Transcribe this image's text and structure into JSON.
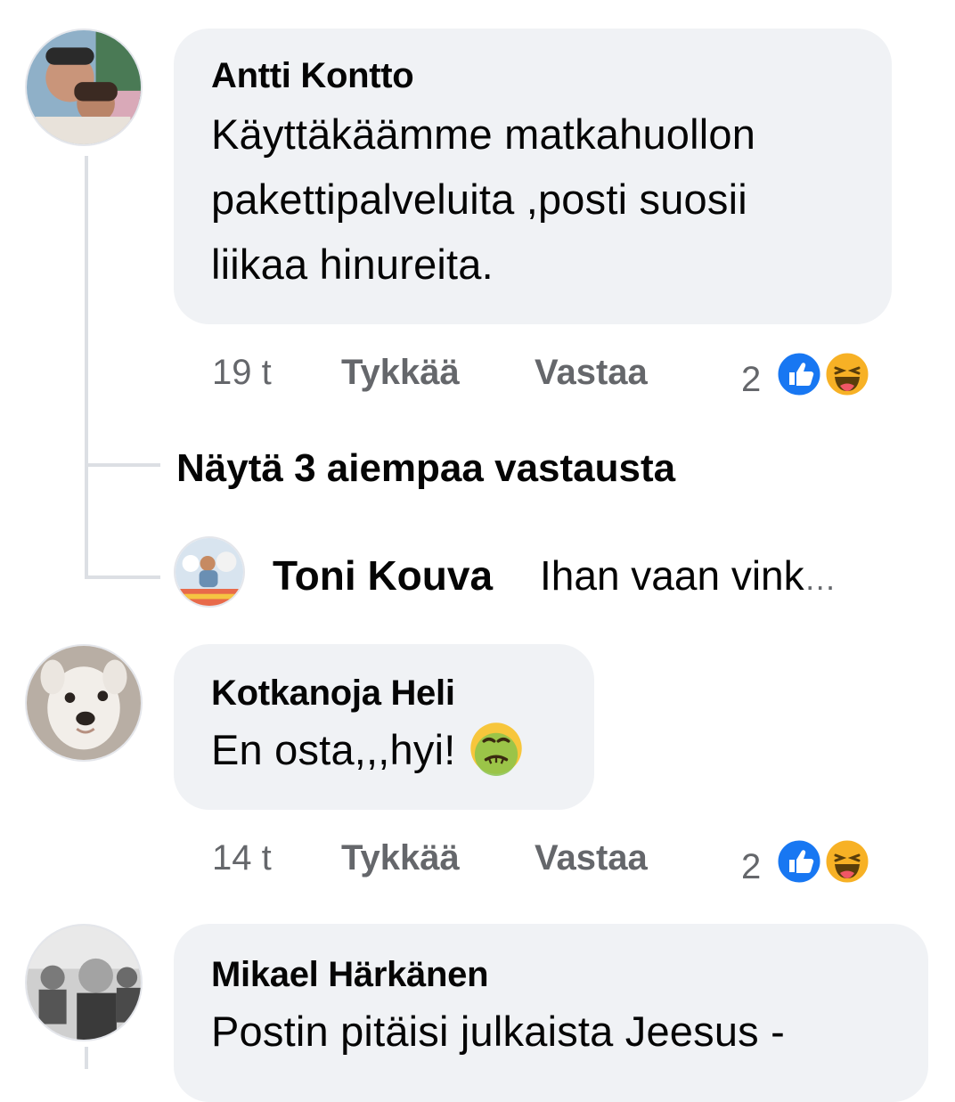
{
  "comments": [
    {
      "author": "Antti Kontto",
      "lines": [
        "Käyttäkäämme matkahuollon",
        "pakettipalveluita ,posti suosii",
        "liikaa hinureita."
      ],
      "time": "19 t",
      "like_label": "Tykkää",
      "reply_label": "Vastaa",
      "reaction_count": "2",
      "reactions": [
        "like-icon",
        "haha-icon"
      ]
    },
    {
      "author": "Kotkanoja Heli",
      "text": "En osta,,,hyi!",
      "emoji": "nauseated-face-icon",
      "time": "14 t",
      "like_label": "Tykkää",
      "reply_label": "Vastaa",
      "reaction_count": "2",
      "reactions": [
        "like-icon",
        "haha-icon"
      ]
    },
    {
      "author": "Mikael Härkänen",
      "text": "Postin pitäisi julkaista Jeesus -"
    }
  ],
  "replies": {
    "show_more_label": "Näytä 3 aiempaa vastausta",
    "latest_author": "Toni Kouva",
    "latest_text": "Ihan vaan vink",
    "ellipsis": "…"
  },
  "colors": {
    "bubble": "#f0f2f5",
    "meta_text": "#65676b",
    "like_blue": "#1877f2",
    "haha_yellow": "#f7b125"
  }
}
